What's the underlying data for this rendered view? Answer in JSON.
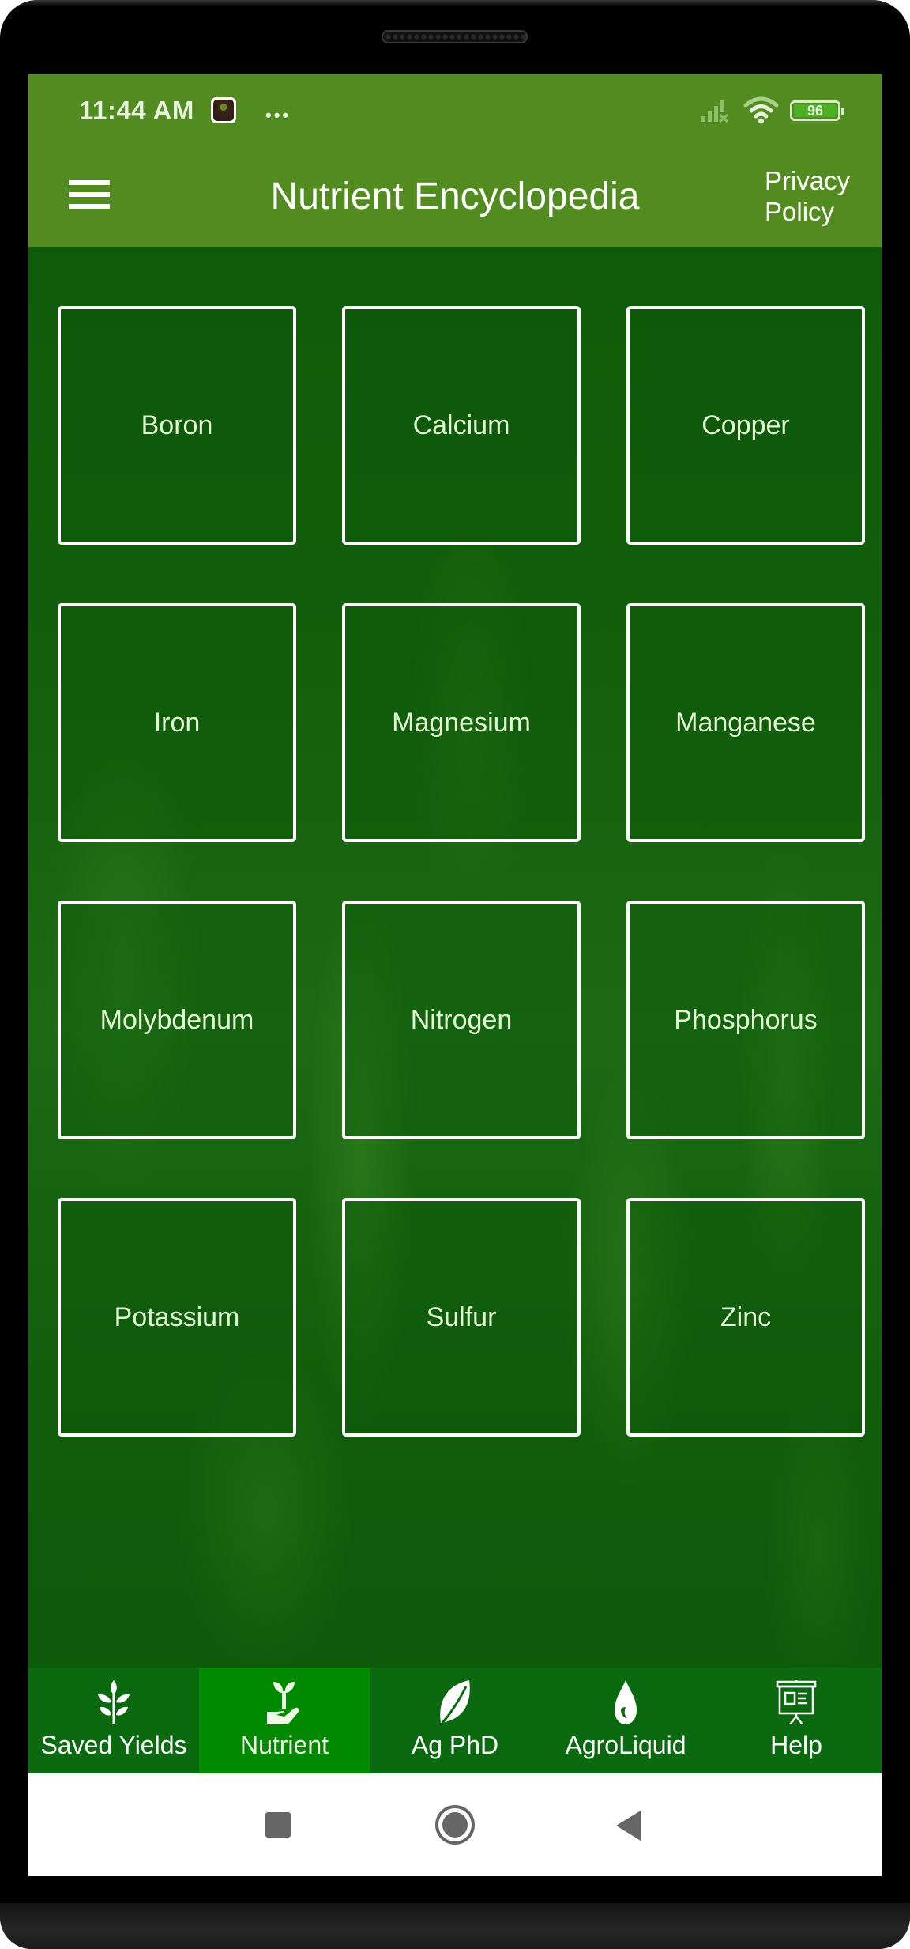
{
  "status_bar": {
    "time": "11:44 AM",
    "overflow_dots": "•••",
    "battery_level": "96",
    "icons": [
      "app-notification-icon",
      "signal-icon",
      "wifi-icon",
      "battery-icon"
    ]
  },
  "header": {
    "title": "Nutrient Encyclopedia",
    "privacy_link": "Privacy Policy",
    "menu_icon": "hamburger-menu-icon"
  },
  "colors": {
    "app_bar": "#528c20",
    "nav_bar": "#0b6a10",
    "nav_active": "#018a01",
    "tile_border": "#ffffff",
    "tile_text": "#e4f7d4"
  },
  "nutrients": [
    {
      "label": "Boron"
    },
    {
      "label": "Calcium"
    },
    {
      "label": "Copper"
    },
    {
      "label": "Iron"
    },
    {
      "label": "Magnesium"
    },
    {
      "label": "Manganese"
    },
    {
      "label": "Molybdenum"
    },
    {
      "label": "Nitrogen"
    },
    {
      "label": "Phosphorus"
    },
    {
      "label": "Potassium"
    },
    {
      "label": "Sulfur"
    },
    {
      "label": "Zinc"
    }
  ],
  "bottom_nav": {
    "active_index": 1,
    "items": [
      {
        "label": "Saved Yields",
        "icon": "wheat-icon"
      },
      {
        "label": "Nutrient",
        "icon": "seedling-hand-icon"
      },
      {
        "label": "Ag PhD",
        "icon": "leaf-icon"
      },
      {
        "label": "AgroLiquid",
        "icon": "droplet-icon"
      },
      {
        "label": "Help",
        "icon": "presentation-board-icon"
      }
    ]
  },
  "system_nav": {
    "buttons": [
      "recents-icon",
      "home-icon",
      "back-icon"
    ]
  }
}
